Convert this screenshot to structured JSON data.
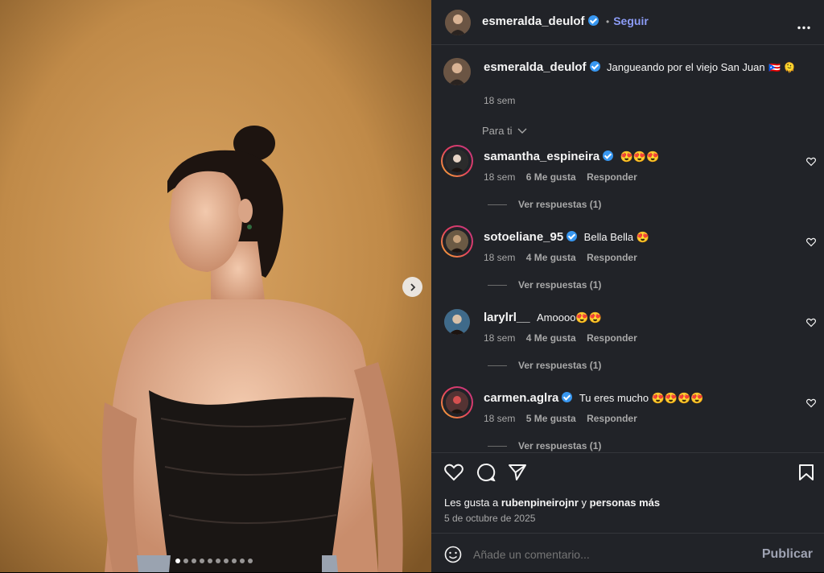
{
  "post_author": {
    "username": "esmeralda_deulof",
    "follow_label": "Seguir",
    "separator": "•"
  },
  "caption": {
    "username": "esmeralda_deulof",
    "text": "Jangueando por el viejo San Juan",
    "emojis": "🇵🇷 🫠",
    "time": "18 sem"
  },
  "filter_label": "Para ti",
  "comments": [
    {
      "username": "samantha_espineira",
      "verified": true,
      "text": "😍😍😍",
      "time": "18 sem",
      "likes": "6 Me gusta",
      "reply": "Responder",
      "view_replies": "Ver respuestas (1)"
    },
    {
      "username": "sotoeliane_95",
      "verified": true,
      "text": "Bella Bella 😍",
      "time": "18 sem",
      "likes": "4 Me gusta",
      "reply": "Responder",
      "view_replies": "Ver respuestas (1)"
    },
    {
      "username": "larylrl__",
      "verified": false,
      "text": "Amoooo😍😍",
      "time": "18 sem",
      "likes": "4 Me gusta",
      "reply": "Responder",
      "view_replies": "Ver respuestas (1)"
    },
    {
      "username": "carmen.aglra",
      "verified": true,
      "text": "Tu eres mucho 😍😍😍😍",
      "time": "18 sem",
      "likes": "5 Me gusta",
      "reply": "Responder",
      "view_replies": "Ver respuestas (1)"
    }
  ],
  "likes_summary": {
    "prefix": "Les gusta a",
    "user": "rubenpineirojnr",
    "connector": "y",
    "suffix": "personas más"
  },
  "post_date": "5 de octubre de 2025",
  "comment_input": {
    "placeholder": "Añade un comentario...",
    "publish_label": "Publicar"
  },
  "carousel": {
    "total": 10,
    "active": 1
  },
  "colors": {
    "panel_bg": "#212328",
    "verified": "#3897f0",
    "follow": "#8c9cf7"
  }
}
